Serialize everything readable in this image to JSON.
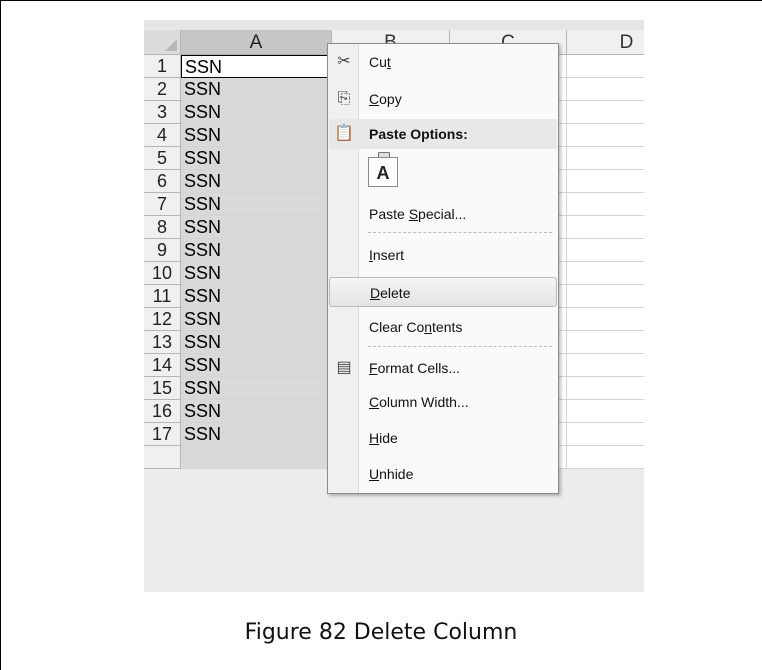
{
  "columns": [
    "A",
    "B",
    "C",
    "D"
  ],
  "selected_column": "A",
  "rows": [
    {
      "num": "1",
      "a": "SSN"
    },
    {
      "num": "2",
      "a": "SSN"
    },
    {
      "num": "3",
      "a": "SSN"
    },
    {
      "num": "4",
      "a": "SSN"
    },
    {
      "num": "5",
      "a": "SSN"
    },
    {
      "num": "6",
      "a": "SSN"
    },
    {
      "num": "7",
      "a": "SSN"
    },
    {
      "num": "8",
      "a": "SSN"
    },
    {
      "num": "9",
      "a": "SSN"
    },
    {
      "num": "10",
      "a": "SSN"
    },
    {
      "num": "11",
      "a": "SSN"
    },
    {
      "num": "12",
      "a": "SSN"
    },
    {
      "num": "13",
      "a": "SSN"
    },
    {
      "num": "14",
      "a": "SSN"
    },
    {
      "num": "15",
      "a": "SSN"
    },
    {
      "num": "16",
      "a": "SSN"
    },
    {
      "num": "17",
      "a": "SSN"
    }
  ],
  "context_menu": {
    "items": [
      {
        "id": "cut",
        "pre": "Cu",
        "ul": "t",
        "post": "",
        "icon": "cut-icon",
        "glyph": "✂"
      },
      {
        "id": "copy",
        "pre": "",
        "ul": "C",
        "post": "opy",
        "icon": "copy-icon",
        "glyph": "⎘"
      },
      {
        "id": "paste-options",
        "pre": "Paste Options:",
        "ul": "",
        "post": "",
        "icon": "paste-icon",
        "glyph": "📋"
      },
      {
        "id": "paste-special",
        "pre": "Paste ",
        "ul": "S",
        "post": "pecial...",
        "icon": "",
        "glyph": ""
      },
      {
        "id": "insert",
        "pre": "",
        "ul": "I",
        "post": "nsert",
        "icon": "",
        "glyph": ""
      },
      {
        "id": "delete",
        "pre": "",
        "ul": "D",
        "post": "elete",
        "icon": "",
        "glyph": ""
      },
      {
        "id": "clear-contents",
        "pre": "Clear Co",
        "ul": "n",
        "post": "tents",
        "icon": "",
        "glyph": ""
      },
      {
        "id": "format-cells",
        "pre": "",
        "ul": "F",
        "post": "ormat Cells...",
        "icon": "format-cells-icon",
        "glyph": "▤"
      },
      {
        "id": "column-width",
        "pre": "",
        "ul": "C",
        "post": "olumn Width...",
        "icon": "",
        "glyph": ""
      },
      {
        "id": "hide",
        "pre": "",
        "ul": "H",
        "post": "ide",
        "icon": "",
        "glyph": ""
      },
      {
        "id": "unhide",
        "pre": "",
        "ul": "U",
        "post": "nhide",
        "icon": "",
        "glyph": ""
      }
    ],
    "paste_button_label": "A",
    "highlighted": "delete"
  },
  "caption": "Figure 82 Delete Column"
}
